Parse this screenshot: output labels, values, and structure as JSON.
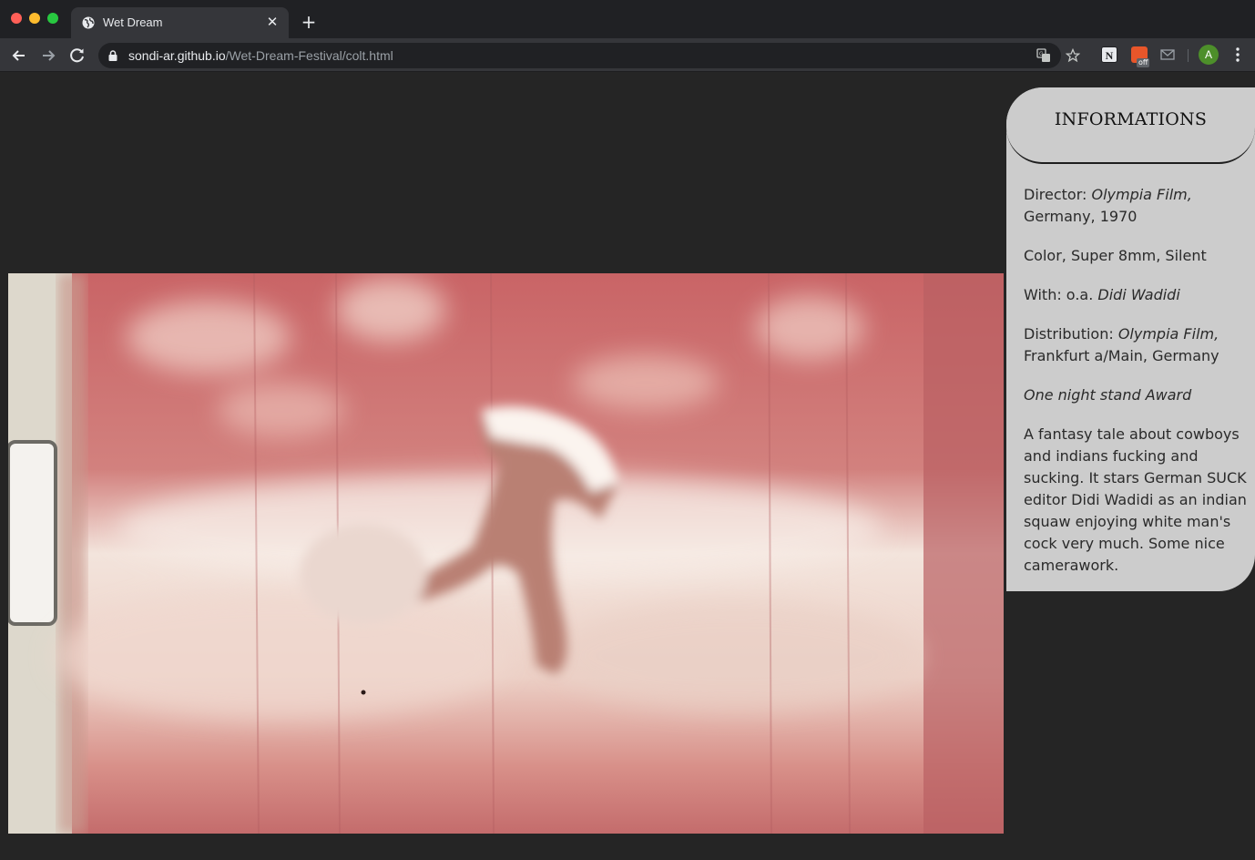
{
  "browser": {
    "tab_title": "Wet Dream",
    "tab_close": "✕",
    "new_tab": "+",
    "url_host": "sondi-ar.github.io",
    "url_path": "/Wet-Dream-Festival/colt.html",
    "profile_initial": "A",
    "ext_badge": "off",
    "icons": {
      "back": "arrow-left-icon",
      "forward": "arrow-right-icon",
      "reload": "reload-icon",
      "lock": "lock-icon",
      "translate": "translate-icon",
      "bookmark": "star-icon",
      "menu": "kebab-menu-icon"
    }
  },
  "page": {
    "info": {
      "heading": "INFORMATIONS",
      "director_label": "Director: ",
      "director_value": "Olympia Film,",
      "director_rest": "Germany, 1970",
      "format": "Color, Super 8mm, Silent",
      "with_label": "With: o.a. ",
      "with_value": "Didi Wadidi",
      "distribution_label": "Distribution: ",
      "distribution_value": "Olympia Film,",
      "distribution_rest": "Frankfurt a/Main, Germany",
      "award": "One night stand Award",
      "synopsis": "A fantasy tale about cowboys and indians fucking and sucking. It stars German SUCK editor Didi Wadidi as an indian squaw enjoying white man's cock very much. Some nice camerawork."
    }
  },
  "colors": {
    "page_bg": "#252525",
    "panel_bg": "#cccccc",
    "tab_active": "#35363a",
    "tabbar": "#202124"
  }
}
